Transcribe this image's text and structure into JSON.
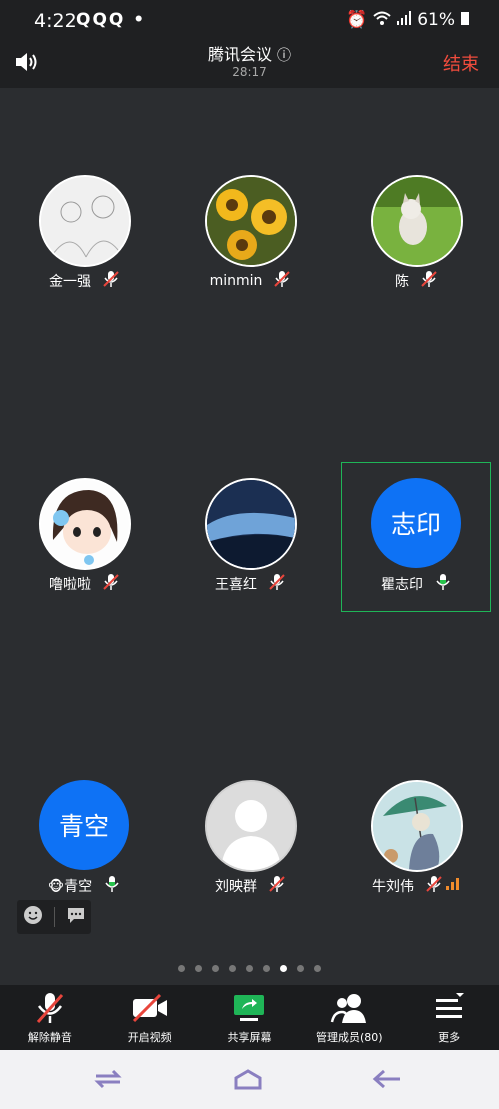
{
  "status": {
    "time": "4:22",
    "left_icons": "QQQ •",
    "battery": "61%"
  },
  "header": {
    "title": "腾讯会议",
    "elapsed": "28:17",
    "end": "结束"
  },
  "participants": [
    {
      "name": "金一强",
      "avatar": "photo",
      "mic": "muted"
    },
    {
      "name": "minmin",
      "avatar": "sunflower",
      "mic": "muted"
    },
    {
      "name": "陈",
      "avatar": "kitten",
      "mic": "muted"
    },
    {
      "name": "噜啦啦",
      "avatar": "cartoon-girl",
      "mic": "muted"
    },
    {
      "name": "王喜红",
      "avatar": "sky",
      "mic": "muted"
    },
    {
      "name": "瞿志印",
      "avatar_text": "志印",
      "mic": "on",
      "selected": true
    },
    {
      "name": "青空",
      "avatar_text": "青空",
      "emoji": "🐵",
      "mic": "on"
    },
    {
      "name": "刘映群",
      "avatar": "default-person",
      "mic": "muted"
    },
    {
      "name": "牛刘伟",
      "avatar": "umbrella-painting",
      "mic": "muted",
      "signal": "weak"
    }
  ],
  "pager": {
    "count": 9,
    "active_index": 6
  },
  "toolbar": {
    "unmute": "解除静音",
    "video": "开启视频",
    "share": "共享屏幕",
    "members": "管理成员(80)",
    "more": "更多"
  },
  "colors": {
    "accent_blue": "#0e72f5",
    "end_red": "#f24c3d",
    "mic_green": "#27c24c",
    "muted_red": "#e8453c",
    "share_green": "#1fb557"
  }
}
